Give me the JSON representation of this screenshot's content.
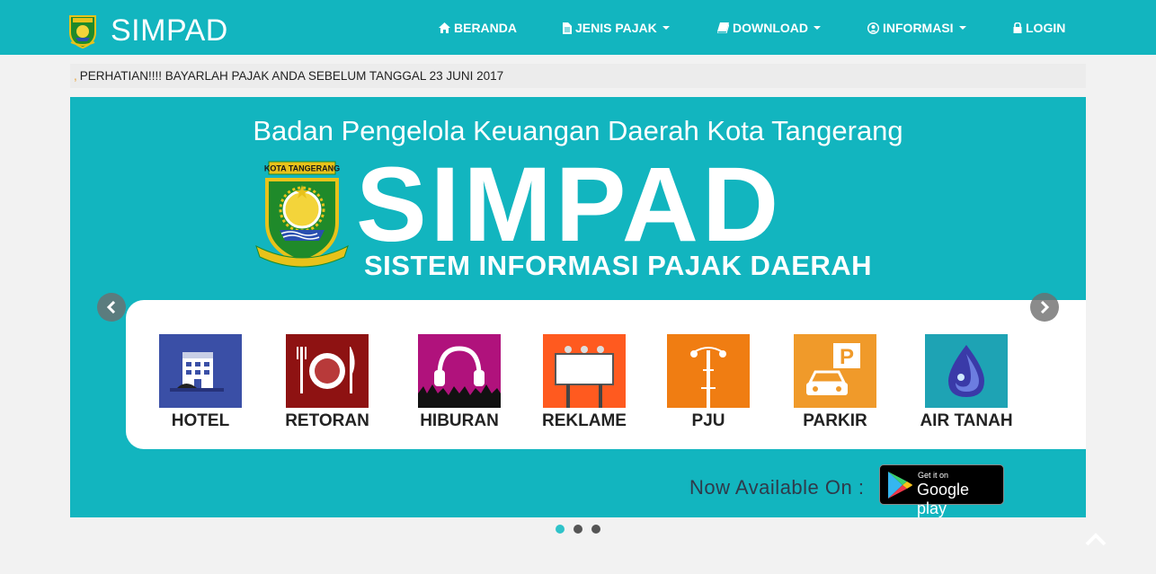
{
  "brand": {
    "title": "SIMPAD"
  },
  "nav": [
    {
      "label": "BERANDA",
      "icon": "home-icon",
      "dropdown": false
    },
    {
      "label": "JENIS PAJAK",
      "icon": "file-icon",
      "dropdown": true
    },
    {
      "label": "DOWNLOAD",
      "icon": "book-icon",
      "dropdown": true
    },
    {
      "label": "INFORMASI",
      "icon": "user-circle-icon",
      "dropdown": true
    },
    {
      "label": "LOGIN",
      "icon": "lock-icon",
      "dropdown": false
    }
  ],
  "announcement": {
    "prefix": ",",
    "text": "PERHATIAN!!!! BAYARLAH PAJAK ANDA SEBELUM TANGGAL 23 JUNI 2017"
  },
  "banner": {
    "title": "Badan Pengelola Keuangan Daerah Kota Tangerang",
    "emblem_text": "KOTA TANGERANG",
    "emblem_motto": "BHAKTI KARYA ADHI KERTA RAHARJA",
    "headline": "SIMPAD",
    "subtitle": "SISTEM INFORMASI PAJAK DAERAH",
    "categories": [
      {
        "label": "HOTEL",
        "icon": "hotel-icon",
        "color": "#3a4fa6"
      },
      {
        "label": "RETORAN",
        "icon": "restaurant-icon",
        "color": "#8e1212"
      },
      {
        "label": "HIBURAN",
        "icon": "headphones-icon",
        "color": "#b0127c"
      },
      {
        "label": "REKLAME",
        "icon": "billboard-icon",
        "color": "#ff5a1f"
      },
      {
        "label": "PJU",
        "icon": "street-light-icon",
        "color": "#f07d12"
      },
      {
        "label": "PARKIR",
        "icon": "parking-icon",
        "color": "#f09a2a"
      },
      {
        "label": "AIR TANAH",
        "icon": "water-drop-icon",
        "color": "#1ea3b4"
      }
    ],
    "available_text": "Now Available On :",
    "store": {
      "small": "Get it on",
      "big": "Google play"
    }
  },
  "carousel": {
    "slide_count": 3,
    "active_index": 0
  },
  "colors": {
    "primary": "#12b5bf",
    "page_bg": "#f2f2f2"
  }
}
